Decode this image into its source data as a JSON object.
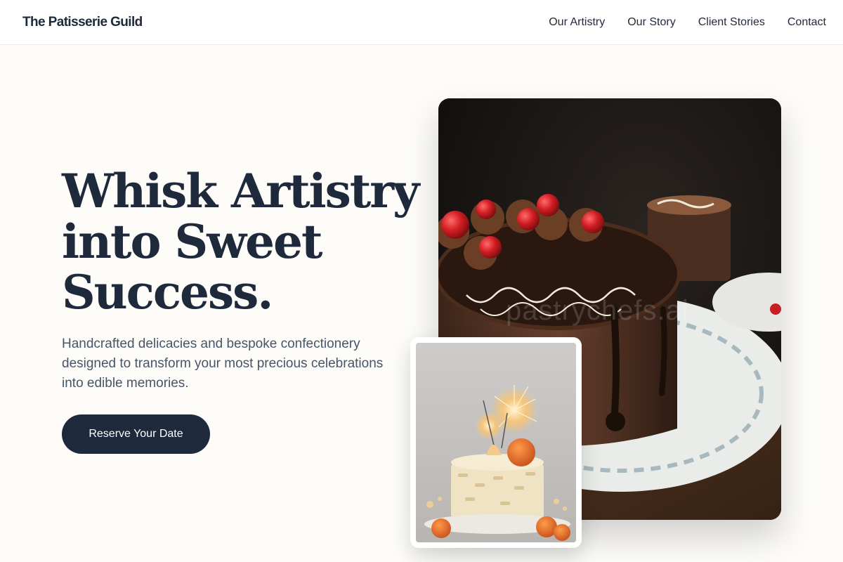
{
  "brand": {
    "name": "The Patisserie Guild"
  },
  "nav": {
    "items": [
      {
        "label": "Our Artistry"
      },
      {
        "label": "Our Story"
      },
      {
        "label": "Client Stories"
      },
      {
        "label": "Contact"
      }
    ]
  },
  "hero": {
    "title_line1": "Whisk Artistry",
    "title_line2": "into Sweet",
    "title_line3": "Success.",
    "subtitle": "Handcrafted delicacies and bespoke confectionery designed to transform your most precious celebrations into edible memories.",
    "cta_label": "Reserve Your Date"
  },
  "images": {
    "main_watermark": "pastrychefs.ai",
    "main_icon": "chocolate-cake-photo",
    "inset_icon": "sparkler-cake-photo"
  },
  "colors": {
    "ink": "#1e293b",
    "muted": "#475569",
    "background": "#fdfcf8",
    "button": "#1e293b"
  }
}
